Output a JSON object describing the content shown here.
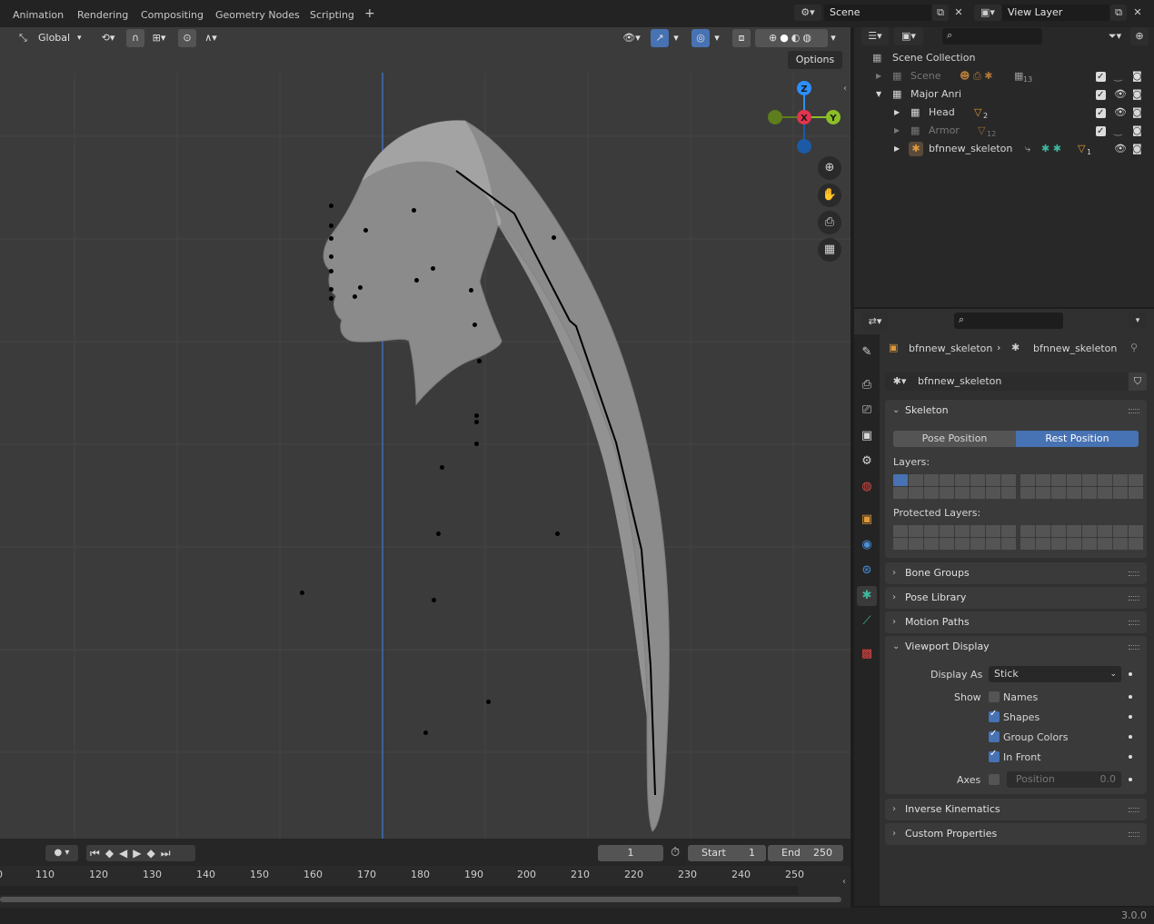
{
  "topbar": {
    "workspace_tabs": [
      "Animation",
      "Rendering",
      "Compositing",
      "Geometry Nodes",
      "Scripting"
    ],
    "add_tab": "+",
    "scene_name": "Scene",
    "view_layer": "View Layer"
  },
  "viewport": {
    "orientation": "Global",
    "options_label": "Options",
    "gizmo": {
      "z": "Z",
      "x": "X",
      "y": "Y"
    }
  },
  "timeline": {
    "current_frame": "1",
    "start_label": "Start",
    "start_value": "1",
    "end_label": "End",
    "end_value": "250",
    "ticks": [
      "0",
      "110",
      "120",
      "130",
      "140",
      "150",
      "160",
      "170",
      "180",
      "190",
      "200",
      "210",
      "220",
      "230",
      "240",
      "250"
    ]
  },
  "outliner": {
    "root": "Scene Collection",
    "rows": [
      {
        "label": "Scene",
        "badge": "13"
      },
      {
        "label": "Major Anri"
      },
      {
        "label": "Head",
        "badge": "2"
      },
      {
        "label": "Armor",
        "badge": "12"
      },
      {
        "label": "bfnnew_skeleton",
        "badge": "1"
      }
    ]
  },
  "properties": {
    "breadcrumb_object": "bfnnew_skeleton",
    "breadcrumb_data": "bfnnew_skeleton",
    "data_name": "bfnnew_skeleton",
    "skeleton": {
      "title": "Skeleton",
      "pose_position": "Pose Position",
      "rest_position": "Rest Position",
      "layers_label": "Layers:",
      "protected_label": "Protected Layers:"
    },
    "collapsed_panels": [
      "Bone Groups",
      "Pose Library",
      "Motion Paths"
    ],
    "viewport_display": {
      "title": "Viewport Display",
      "display_as_label": "Display As",
      "display_as_value": "Stick",
      "show_label": "Show",
      "names": "Names",
      "shapes": "Shapes",
      "group_colors": "Group Colors",
      "in_front": "In Front",
      "axes_label": "Axes",
      "position_label": "Position",
      "position_value": "0.0"
    },
    "bottom_panels": [
      "Inverse Kinematics",
      "Custom Properties"
    ]
  },
  "statusbar": {
    "version": "3.0.0"
  },
  "colors": {
    "accent": "#4772b3",
    "axis_x": "#e3344f",
    "axis_y": "#8cbe27",
    "axis_z": "#2c8fff"
  }
}
